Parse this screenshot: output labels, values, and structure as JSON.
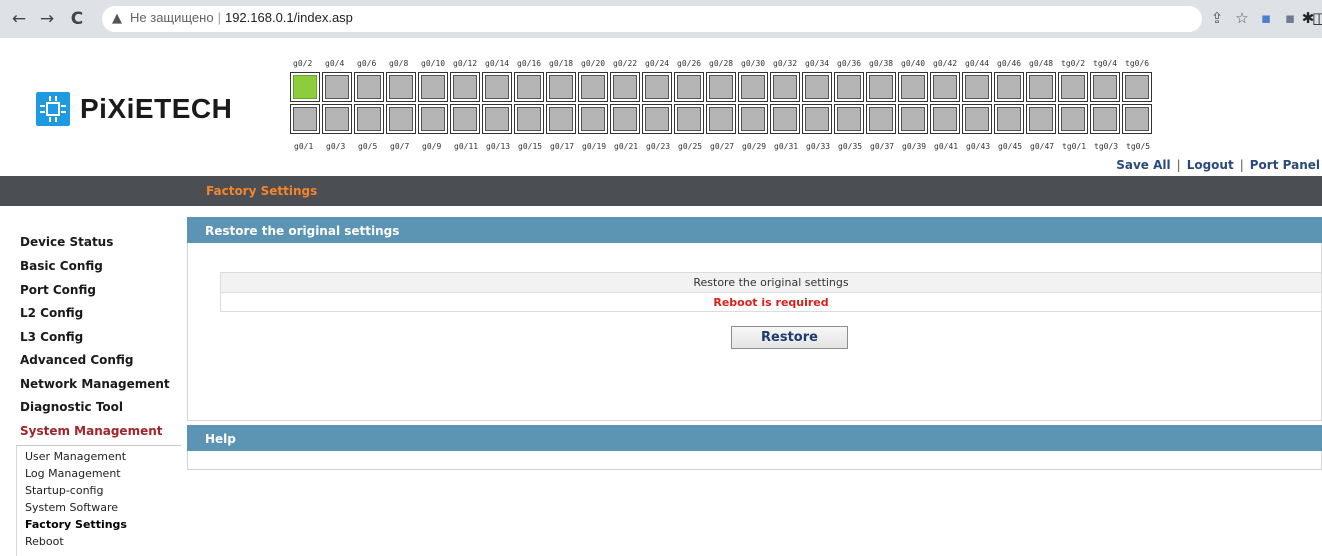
{
  "browser": {
    "back_icon": "←",
    "forward_icon": "→",
    "reload_icon": "C",
    "warning_icon": "▲",
    "security_text": "Не защищено",
    "url": "192.168.0.1/index.asp",
    "share_icon": "⇪",
    "star_icon": "☆",
    "ext1_icon": "▪",
    "ext2_icon": "▪",
    "puzzle_icon": "✱",
    "sidepanel_icon": "◫"
  },
  "logo": {
    "text": "PiXiETECH"
  },
  "ports": {
    "top_labels": [
      "g0/2",
      "g0/4",
      "g0/6",
      "g0/8",
      "g0/10",
      "g0/12",
      "g0/14",
      "g0/16",
      "g0/18",
      "g0/20",
      "g0/22",
      "g0/24",
      "g0/26",
      "g0/28",
      "g0/30",
      "g0/32",
      "g0/34",
      "g0/36",
      "g0/38",
      "g0/40",
      "g0/42",
      "g0/44",
      "g0/46",
      "g0/48",
      "tg0/2",
      "tg0/4",
      "tg0/6"
    ],
    "bottom_labels": [
      "g0/1",
      "g0/3",
      "g0/5",
      "g0/7",
      "g0/9",
      "g0/11",
      "g0/13",
      "g0/15",
      "g0/17",
      "g0/19",
      "g0/21",
      "g0/23",
      "g0/25",
      "g0/27",
      "g0/29",
      "g0/31",
      "g0/33",
      "g0/35",
      "g0/37",
      "g0/39",
      "g0/41",
      "g0/43",
      "g0/45",
      "g0/47",
      "tg0/1",
      "tg0/3",
      "tg0/5"
    ],
    "up_port": "g0/2",
    "colors": {
      "up": "#8ccd3d",
      "down": "#b5b5b5"
    }
  },
  "top_links": {
    "save_all": "Save All",
    "logout": "Logout",
    "port_panel": "Port Panel",
    "sep": "|"
  },
  "title_bar": {
    "crumb": "Factory Settings"
  },
  "sidebar": {
    "items": [
      "Device Status",
      "Basic Config",
      "Port Config",
      "L2 Config",
      "L3 Config",
      "Advanced Config",
      "Network Management",
      "Diagnostic Tool",
      "System Management"
    ],
    "active": "System Management",
    "submenu": [
      "User Management",
      "Log Management",
      "Startup-config",
      "System Software",
      "Factory Settings",
      "Reboot"
    ],
    "submenu_active": "Factory Settings"
  },
  "main": {
    "panel_title": "Restore the original settings",
    "table_header": "Restore the original settings",
    "reboot_notice": "Reboot is required",
    "restore_label": "Restore",
    "help_title": "Help"
  },
  "colors": {
    "panel_header": "#5b95b3",
    "title_bar": "#4b4f53",
    "crumb": "#f5842b",
    "warning_text": "#d6201b",
    "active_menu": "#a0252a"
  }
}
